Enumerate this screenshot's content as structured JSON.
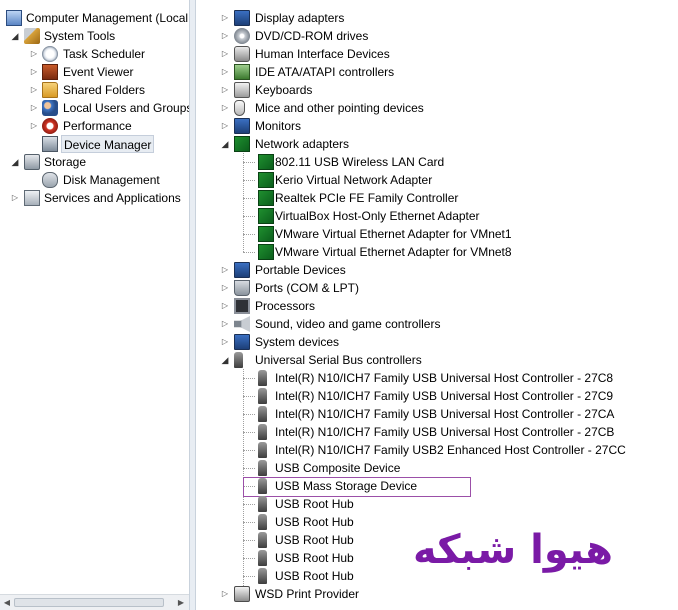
{
  "left_tree": [
    {
      "label": "Computer Management (Local",
      "icon": "computer-icon",
      "expander": "none"
    },
    {
      "label": "System Tools",
      "icon": "tools-icon",
      "expander": "expanded"
    },
    {
      "label": "Task Scheduler",
      "icon": "clock-icon",
      "expander": "collapsed"
    },
    {
      "label": "Event Viewer",
      "icon": "event-viewer-icon",
      "expander": "collapsed"
    },
    {
      "label": "Shared Folders",
      "icon": "shared-folder-icon",
      "expander": "collapsed"
    },
    {
      "label": "Local Users and Groups",
      "icon": "users-icon",
      "expander": "collapsed"
    },
    {
      "label": "Performance",
      "icon": "performance-icon",
      "expander": "collapsed"
    },
    {
      "label": "Device Manager",
      "icon": "device-manager-icon",
      "expander": "none",
      "selected": true
    },
    {
      "label": "Storage",
      "icon": "storage-icon",
      "expander": "expanded"
    },
    {
      "label": "Disk Management",
      "icon": "disk-icon",
      "expander": "none"
    },
    {
      "label": "Services and Applications",
      "icon": "services-icon",
      "expander": "collapsed"
    }
  ],
  "right_tree": [
    {
      "label": "Display adapters",
      "icon": "monitor-icon",
      "expander": "collapsed"
    },
    {
      "label": "DVD/CD-ROM drives",
      "icon": "dvd-icon",
      "expander": "collapsed"
    },
    {
      "label": "Human Interface Devices",
      "icon": "hid-icon",
      "expander": "collapsed"
    },
    {
      "label": "IDE ATA/ATAPI controllers",
      "icon": "ide-icon",
      "expander": "collapsed"
    },
    {
      "label": "Keyboards",
      "icon": "keyboard-icon",
      "expander": "collapsed"
    },
    {
      "label": "Mice and other pointing devices",
      "icon": "mouse-icon",
      "expander": "collapsed"
    },
    {
      "label": "Monitors",
      "icon": "monitor-icon",
      "expander": "collapsed"
    },
    {
      "label": "Network adapters",
      "icon": "network-icon",
      "expander": "expanded"
    },
    {
      "label": "802.11 USB Wireless LAN Card",
      "icon": "network-adapter-icon",
      "expander": "child"
    },
    {
      "label": "Kerio Virtual Network Adapter",
      "icon": "network-adapter-icon",
      "expander": "child"
    },
    {
      "label": "Realtek PCIe FE Family Controller",
      "icon": "network-adapter-icon",
      "expander": "child"
    },
    {
      "label": "VirtualBox Host-Only Ethernet Adapter",
      "icon": "network-adapter-icon",
      "expander": "child"
    },
    {
      "label": "VMware Virtual Ethernet Adapter for VMnet1",
      "icon": "network-adapter-icon",
      "expander": "child"
    },
    {
      "label": "VMware Virtual Ethernet Adapter for VMnet8",
      "icon": "network-adapter-icon",
      "expander": "child"
    },
    {
      "label": "Portable Devices",
      "icon": "portable-device-icon",
      "expander": "collapsed"
    },
    {
      "label": "Ports (COM & LPT)",
      "icon": "port-icon",
      "expander": "collapsed"
    },
    {
      "label": "Processors",
      "icon": "processor-icon",
      "expander": "collapsed"
    },
    {
      "label": "Sound, video and game controllers",
      "icon": "speaker-icon",
      "expander": "collapsed"
    },
    {
      "label": "System devices",
      "icon": "system-device-icon",
      "expander": "collapsed"
    },
    {
      "label": "Universal Serial Bus controllers",
      "icon": "usb-icon",
      "expander": "expanded"
    },
    {
      "label": "Intel(R) N10/ICH7 Family USB Universal Host Controller - 27C8",
      "icon": "usb-icon",
      "expander": "child"
    },
    {
      "label": "Intel(R) N10/ICH7 Family USB Universal Host Controller - 27C9",
      "icon": "usb-icon",
      "expander": "child"
    },
    {
      "label": "Intel(R) N10/ICH7 Family USB Universal Host Controller - 27CA",
      "icon": "usb-icon",
      "expander": "child"
    },
    {
      "label": "Intel(R) N10/ICH7 Family USB Universal Host Controller - 27CB",
      "icon": "usb-icon",
      "expander": "child"
    },
    {
      "label": "Intel(R) N10/ICH7 Family USB2 Enhanced Host Controller - 27CC",
      "icon": "usb-icon",
      "expander": "child"
    },
    {
      "label": "USB Composite Device",
      "icon": "usb-icon",
      "expander": "child"
    },
    {
      "label": "USB Mass Storage Device",
      "icon": "usb-icon",
      "expander": "child",
      "focused": true
    },
    {
      "label": "USB Root Hub",
      "icon": "usb-icon",
      "expander": "child"
    },
    {
      "label": "USB Root Hub",
      "icon": "usb-icon",
      "expander": "child"
    },
    {
      "label": "USB Root Hub",
      "icon": "usb-icon",
      "expander": "child"
    },
    {
      "label": "USB Root Hub",
      "icon": "usb-icon",
      "expander": "child"
    },
    {
      "label": "USB Root Hub",
      "icon": "usb-icon",
      "expander": "child"
    },
    {
      "label": "WSD Print Provider",
      "icon": "printer-icon",
      "expander": "collapsed"
    }
  ],
  "watermark": "هیوا شبکه",
  "colors": {
    "selection": "#e7ecf2",
    "focus_border": "#9b4fa8",
    "watermark": "#7a1aa6"
  }
}
